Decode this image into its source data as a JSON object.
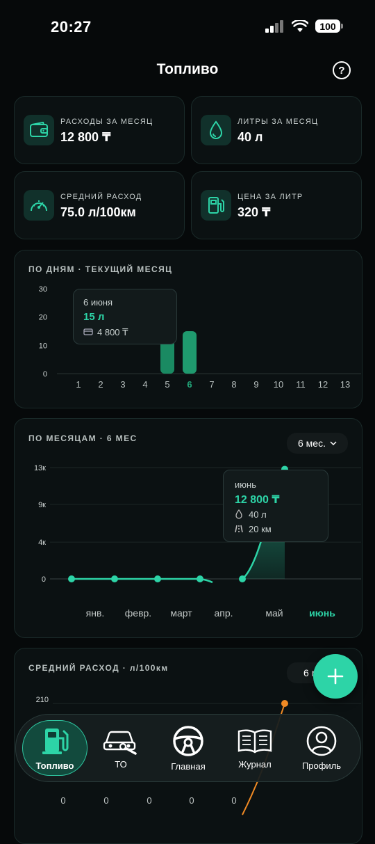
{
  "status_bar": {
    "time": "20:27",
    "battery": "100"
  },
  "header": {
    "title": "Топливо",
    "help_icon": "question-circle-icon"
  },
  "stats": [
    {
      "label": "РАСХОДЫ ЗА МЕСЯЦ",
      "value": "12 800 ₸",
      "icon": "wallet-icon"
    },
    {
      "label": "ЛИТРЫ ЗА МЕСЯЦ",
      "value": "40 л",
      "icon": "droplet-icon"
    },
    {
      "label": "СРЕДНИЙ РАСХОД",
      "value": "75.0 л/100км",
      "icon": "speedometer-icon"
    },
    {
      "label": "ЦЕНА ЗА ЛИТР",
      "value": "320 ₸",
      "icon": "fuel-pump-icon"
    }
  ],
  "daily_section": {
    "title": "ПО ДНЯМ · ТЕКУЩИЙ МЕСЯЦ",
    "tooltip": {
      "date": "6 июня",
      "liters": "15 л",
      "cost": "4 800 ₸"
    }
  },
  "monthly_section": {
    "title": "ПО МЕСЯЦАМ · 6 МЕС",
    "period_select": "6 мес.",
    "tooltip": {
      "month": "июнь",
      "cost": "12 800 ₸",
      "liters": "40 л",
      "distance": "20 км"
    }
  },
  "avg_section": {
    "title": "СРЕДНИЙ РАСХОД · л/100км",
    "period_select": "6 мес."
  },
  "chart_data": [
    {
      "type": "bar",
      "categories": [
        "1",
        "2",
        "3",
        "4",
        "5",
        "6",
        "7",
        "8",
        "9",
        "10",
        "11",
        "12",
        "13"
      ],
      "values": [
        0,
        0,
        0,
        0,
        13,
        15,
        0,
        0,
        0,
        0,
        0,
        0,
        0
      ],
      "yticks": [
        "30",
        "20",
        "10",
        "0"
      ],
      "ylim": [
        0,
        30
      ],
      "highlight": "6",
      "color": "#22a679"
    },
    {
      "type": "area",
      "categories": [
        "янв.",
        "февр.",
        "март",
        "апр.",
        "май",
        "июнь"
      ],
      "values": [
        0,
        0,
        0,
        0,
        0,
        12800
      ],
      "yticks": [
        "13к",
        "9к",
        "4к",
        "0"
      ],
      "ylim": [
        0,
        13000
      ],
      "highlight": "июнь",
      "color": "#2dd4a7"
    },
    {
      "type": "line",
      "values": [
        0,
        0,
        0,
        0,
        0,
        210
      ],
      "value_labels": [
        "0",
        "0",
        "0",
        "0",
        "0"
      ],
      "yticks": [
        "210"
      ],
      "ylim": [
        0,
        210
      ],
      "color": "#f08a24"
    }
  ],
  "nav": [
    {
      "label": "Топливо",
      "icon": "fuel-pump-icon",
      "active": true
    },
    {
      "label": "ТО",
      "icon": "car-wrench-icon",
      "active": false
    },
    {
      "label": "Главная",
      "icon": "steering-wheel-icon",
      "active": false
    },
    {
      "label": "Журнал",
      "icon": "book-icon",
      "active": false
    },
    {
      "label": "Профиль",
      "icon": "user-icon",
      "active": false
    }
  ],
  "fab": {
    "icon": "plus-icon"
  },
  "colors": {
    "accent": "#2dd4a7",
    "accent_dark": "#22a679",
    "background": "#06090a",
    "orange": "#f08a24"
  }
}
